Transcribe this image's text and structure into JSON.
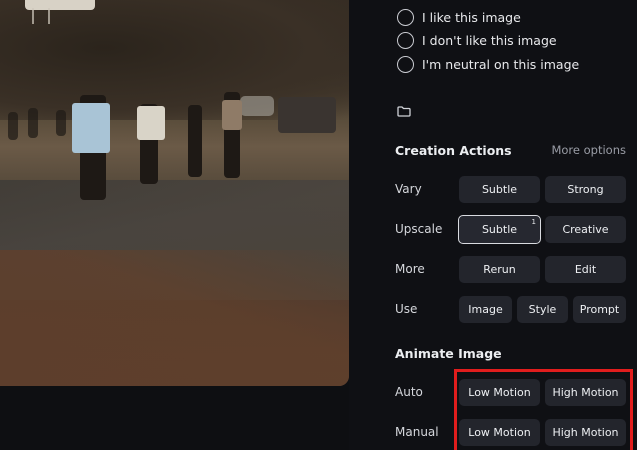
{
  "feedback": {
    "like": "I like this image",
    "dislike": "I don't like this image",
    "neutral": "I'm neutral on this image"
  },
  "creation": {
    "title": "Creation Actions",
    "more_options": "More options",
    "vary": {
      "label": "Vary",
      "subtle": "Subtle",
      "strong": "Strong"
    },
    "upscale": {
      "label": "Upscale",
      "subtle": "Subtle",
      "subtle_badge": "1",
      "creative": "Creative"
    },
    "more": {
      "label": "More",
      "rerun": "Rerun",
      "edit": "Edit"
    },
    "use": {
      "label": "Use",
      "image": "Image",
      "style": "Style",
      "prompt": "Prompt"
    }
  },
  "animate": {
    "title": "Animate Image",
    "auto": {
      "label": "Auto",
      "low": "Low Motion",
      "high": "High Motion"
    },
    "manual": {
      "label": "Manual",
      "low": "Low Motion",
      "high": "High Motion"
    }
  },
  "colors": {
    "highlight": "#e11d1d",
    "panel_bg": "#0f1014",
    "button_bg": "#23252c"
  },
  "icons": {
    "folder": "folder-icon"
  }
}
